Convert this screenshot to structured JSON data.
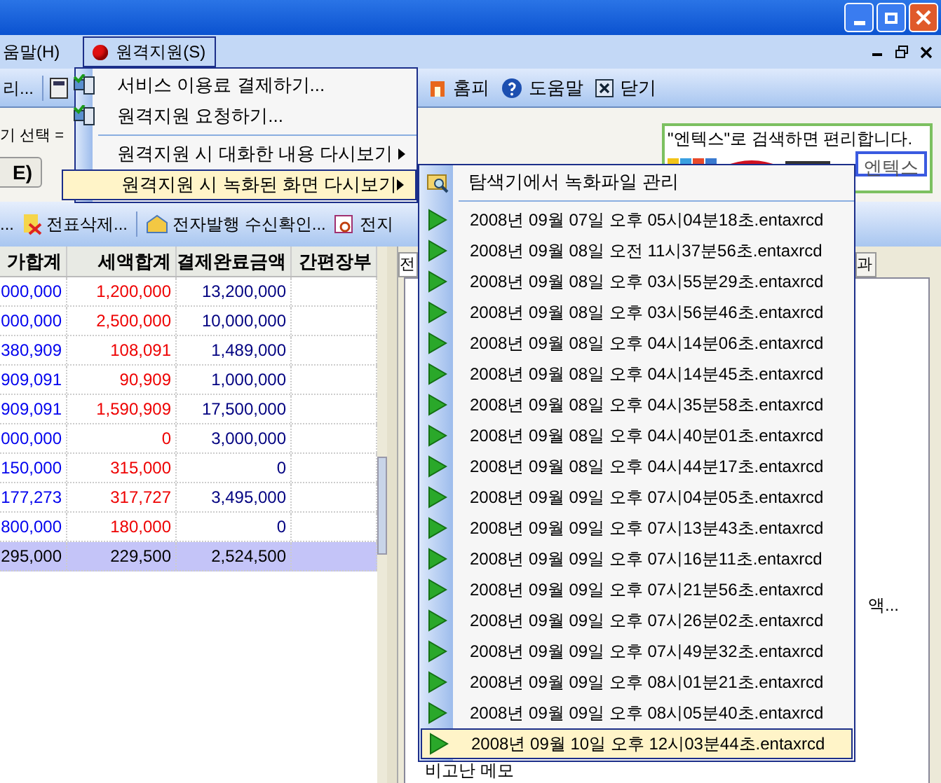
{
  "menu_bar": [
    {
      "label": "움말(H)",
      "selected": false
    },
    {
      "label": "원격지원(S)",
      "selected": true
    }
  ],
  "toolbar": [
    {
      "label": "리..."
    },
    {
      "label": "홈피"
    },
    {
      "label": "도움말"
    },
    {
      "label": "닫기"
    }
  ],
  "period": {
    "label": "기 선택 =",
    "button": "E)"
  },
  "ad": {
    "text": "\"엔텍스\"로 검색하면 편리합니다.",
    "button": "엔텍스"
  },
  "toolbar2": [
    "...",
    "전표삭제...",
    "전자발행 수신확인...",
    "전지"
  ],
  "table": {
    "columns": [
      "가합계",
      "세액합계",
      "결제완료금액",
      "간편장부"
    ],
    "rows": [
      {
        "cells": [
          "000,000",
          "1,200,000",
          "13,200,000",
          ""
        ],
        "selected": false
      },
      {
        "cells": [
          "000,000",
          "2,500,000",
          "10,000,000",
          ""
        ],
        "selected": false
      },
      {
        "cells": [
          "380,909",
          "108,091",
          "1,489,000",
          ""
        ],
        "selected": false
      },
      {
        "cells": [
          "909,091",
          "90,909",
          "1,000,000",
          ""
        ],
        "selected": false
      },
      {
        "cells": [
          "909,091",
          "1,590,909",
          "17,500,000",
          ""
        ],
        "selected": false
      },
      {
        "cells": [
          "000,000",
          "0",
          "3,000,000",
          ""
        ],
        "selected": false
      },
      {
        "cells": [
          "150,000",
          "315,000",
          "0",
          ""
        ],
        "selected": false
      },
      {
        "cells": [
          "177,273",
          "317,727",
          "3,495,000",
          ""
        ],
        "selected": false
      },
      {
        "cells": [
          "800,000",
          "180,000",
          "0",
          ""
        ],
        "selected": false
      },
      {
        "cells": [
          "295,000",
          "229,500",
          "2,524,500",
          ""
        ],
        "selected": true
      }
    ]
  },
  "right_panel": {
    "tabs": [
      "전",
      "과"
    ],
    "note": "액...",
    "memo": "비고난 메모"
  },
  "menu": {
    "items": [
      {
        "label": "서비스 이용료 결제하기...",
        "kind": "action",
        "highlighted": false
      },
      {
        "label": "원격지원 요청하기...",
        "kind": "action",
        "highlighted": false
      },
      {
        "label": "원격지원 시 대화한 내용 다시보기",
        "kind": "submenu",
        "highlighted": false
      },
      {
        "label": "원격지원 시 녹화된 화면 다시보기",
        "kind": "submenu",
        "highlighted": true
      }
    ]
  },
  "submenu": {
    "header": "탐색기에서 녹화파일 관리",
    "items": [
      {
        "label": "2008년 09월 07일 오후 05시04분18초.entaxrcd",
        "selected": false
      },
      {
        "label": "2008년 09월 08일 오전 11시37분56초.entaxrcd",
        "selected": false
      },
      {
        "label": "2008년 09월 08일 오후 03시55분29초.entaxrcd",
        "selected": false
      },
      {
        "label": "2008년 09월 08일 오후 03시56분46초.entaxrcd",
        "selected": false
      },
      {
        "label": "2008년 09월 08일 오후 04시14분06초.entaxrcd",
        "selected": false
      },
      {
        "label": "2008년 09월 08일 오후 04시14분45초.entaxrcd",
        "selected": false
      },
      {
        "label": "2008년 09월 08일 오후 04시35분58초.entaxrcd",
        "selected": false
      },
      {
        "label": "2008년 09월 08일 오후 04시40분01초.entaxrcd",
        "selected": false
      },
      {
        "label": "2008년 09월 08일 오후 04시44분17초.entaxrcd",
        "selected": false
      },
      {
        "label": "2008년 09월 09일 오후 07시04분05초.entaxrcd",
        "selected": false
      },
      {
        "label": "2008년 09월 09일 오후 07시13분43초.entaxrcd",
        "selected": false
      },
      {
        "label": "2008년 09월 09일 오후 07시16분11초.entaxrcd",
        "selected": false
      },
      {
        "label": "2008년 09월 09일 오후 07시21분56초.entaxrcd",
        "selected": false
      },
      {
        "label": "2008년 09월 09일 오후 07시26분02초.entaxrcd",
        "selected": false
      },
      {
        "label": "2008년 09월 09일 오후 07시49분32초.entaxrcd",
        "selected": false
      },
      {
        "label": "2008년 09월 09일 오후 08시01분21초.entaxrcd",
        "selected": false
      },
      {
        "label": "2008년 09월 09일 오후 08시05분40초.entaxrcd",
        "selected": false
      },
      {
        "label": "2008년 09월 10일 오후 12시03분44초.entaxrcd",
        "selected": true
      }
    ]
  }
}
